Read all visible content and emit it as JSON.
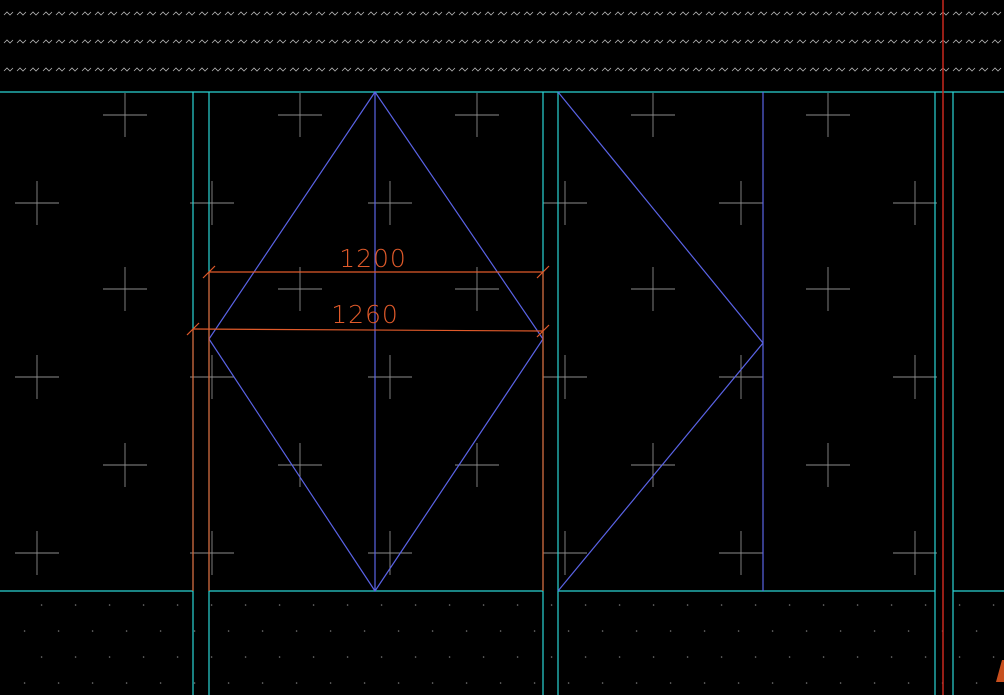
{
  "drawing": {
    "background_color": "#000000",
    "grid_line_color": "#2ad4d4",
    "geometry_line_color": "#5a63e6",
    "dimension_color": "#e05a2a",
    "crosshair_color": "#8c8c8c",
    "hatch_color": "#b4b4b4"
  },
  "dimensions": {
    "upper": {
      "text": "1200"
    },
    "lower": {
      "text": "1260"
    }
  }
}
